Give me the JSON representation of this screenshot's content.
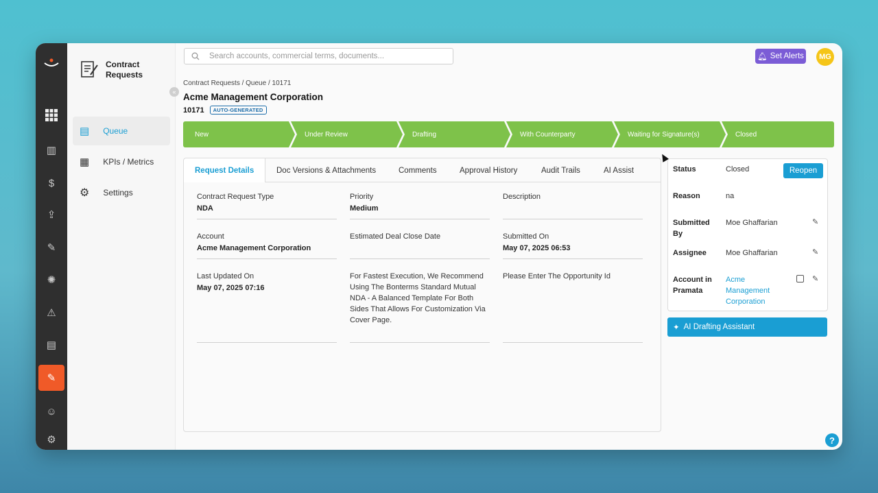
{
  "sidebar": {
    "title": "Contract Requests",
    "items": [
      {
        "label": "Queue",
        "icon": "document-icon"
      },
      {
        "label": "KPIs / Metrics",
        "icon": "chart-icon"
      },
      {
        "label": "Settings",
        "icon": "gear-icon"
      }
    ]
  },
  "search": {
    "placeholder": "Search accounts, commercial terms, documents..."
  },
  "header": {
    "alerts_label": "Set Alerts",
    "avatar_initials": "MG"
  },
  "breadcrumb": "Contract Requests / Queue / 10171",
  "title": "Acme Management Corporation",
  "request_id": "10171",
  "badge": "AUTO-GENERATED",
  "stages": [
    "New",
    "Under Review",
    "Drafting",
    "With Counterparty",
    "Waiting for Signature(s)",
    "Closed"
  ],
  "tabs": [
    "Request Details",
    "Doc Versions & Attachments",
    "Comments",
    "Approval History",
    "Audit Trails",
    "AI Assist"
  ],
  "details": {
    "type_label": "Contract Request Type",
    "type_value": "NDA",
    "priority_label": "Priority",
    "priority_value": "Medium",
    "description_label": "Description",
    "account_label": "Account",
    "account_value": "Acme Management Corporation",
    "close_date_label": "Estimated Deal Close Date",
    "submitted_on_label": "Submitted On",
    "submitted_on_value": "May 07, 2025 06:53",
    "last_updated_label": "Last Updated On",
    "last_updated_value": "May 07, 2025 07:16",
    "recommendation": "For Fastest Execution, We Recommend Using The Bonterms Standard Mutual NDA - A Balanced Template For Both Sides That Allows For Customization Via Cover Page.",
    "opportunity": "Please Enter The Opportunity Id"
  },
  "status_card": {
    "status_label": "Status",
    "status_value": "Closed",
    "reopen_label": "Reopen",
    "reason_label": "Reason",
    "reason_value": "na",
    "submitted_by_label": "Submitted By",
    "submitted_by_value": "Moe Ghaffarian",
    "assignee_label": "Assignee",
    "assignee_value": "Moe Ghaffarian",
    "account_label": "Account in Pramata",
    "account_value": "Acme Management Corporation"
  },
  "ai_button": "AI Drafting Assistant",
  "colors": {
    "accent": "#1a9ed3",
    "stage_green": "#7ec24a",
    "alerts_purple": "#7b5cd6",
    "active_rail": "#f05a28"
  }
}
